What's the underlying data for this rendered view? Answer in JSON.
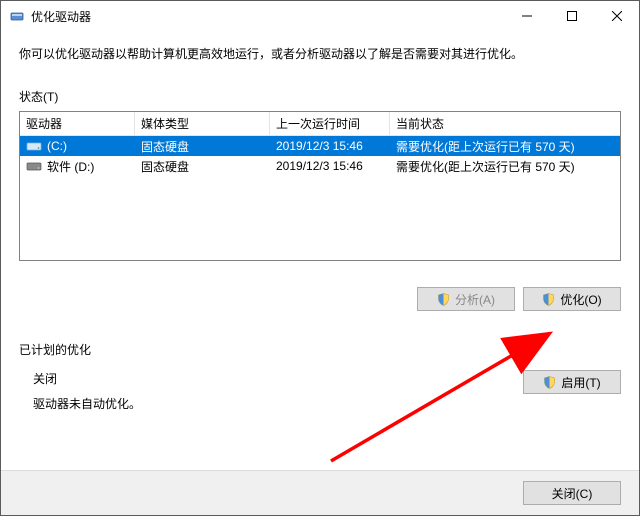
{
  "titlebar": {
    "title": "优化驱动器"
  },
  "description": "你可以优化驱动器以帮助计算机更高效地运行，或者分析驱动器以了解是否需要对其进行优化。",
  "state_label": "状态(T)",
  "table": {
    "headers": {
      "drive": "驱动器",
      "media": "媒体类型",
      "last": "上一次运行时间",
      "status": "当前状态"
    },
    "rows": [
      {
        "drive": "(C:)",
        "media": "固态硬盘",
        "last": "2019/12/3 15:46",
        "status": "需要优化(距上次运行已有 570 天)",
        "selected": true
      },
      {
        "drive": "软件 (D:)",
        "media": "固态硬盘",
        "last": "2019/12/3 15:46",
        "status": "需要优化(距上次运行已有 570 天)",
        "selected": false
      }
    ]
  },
  "buttons": {
    "analyze": "分析(A)",
    "optimize": "优化(O)",
    "enable": "启用(T)",
    "close": "关闭(C)"
  },
  "schedule": {
    "title": "已计划的优化",
    "status": "关闭",
    "desc": "驱动器未自动优化。"
  }
}
